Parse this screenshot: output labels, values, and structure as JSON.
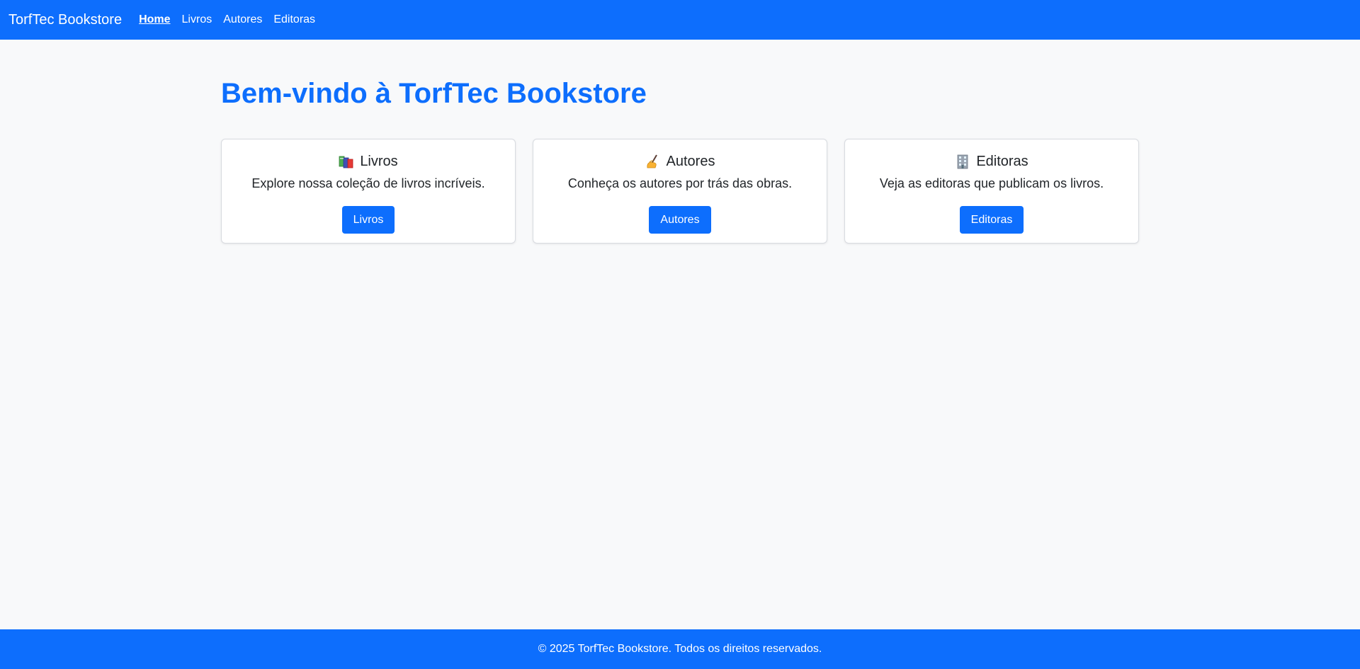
{
  "navbar": {
    "brand": "TorfTec Bookstore",
    "links": [
      {
        "label": "Home",
        "active": true
      },
      {
        "label": "Livros",
        "active": false
      },
      {
        "label": "Autores",
        "active": false
      },
      {
        "label": "Editoras",
        "active": false
      }
    ]
  },
  "main": {
    "title": "Bem-vindo à TorfTec Bookstore",
    "cards": [
      {
        "icon": "books-icon",
        "title": "Livros",
        "text": "Explore nossa coleção de livros incríveis.",
        "button": "Livros"
      },
      {
        "icon": "writing-hand-icon",
        "title": "Autores",
        "text": "Conheça os autores por trás das obras.",
        "button": "Autores"
      },
      {
        "icon": "office-building-icon",
        "title": "Editoras",
        "text": "Veja as editoras que publicam os livros.",
        "button": "Editoras"
      }
    ]
  },
  "footer": {
    "text": "© 2025 TorfTec Bookstore. Todos os direitos reservados."
  },
  "colors": {
    "primary": "#0d6efd",
    "background": "#f8f9fa"
  }
}
